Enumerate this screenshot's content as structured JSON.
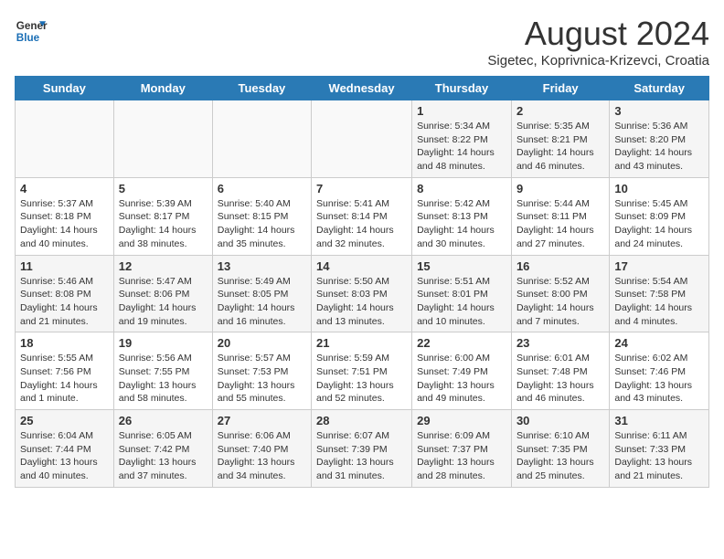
{
  "header": {
    "logo_line1": "General",
    "logo_line2": "Blue",
    "month": "August 2024",
    "location": "Sigetec, Koprivnica-Krizevci, Croatia"
  },
  "days_of_week": [
    "Sunday",
    "Monday",
    "Tuesday",
    "Wednesday",
    "Thursday",
    "Friday",
    "Saturday"
  ],
  "weeks": [
    [
      {
        "day": "",
        "info": ""
      },
      {
        "day": "",
        "info": ""
      },
      {
        "day": "",
        "info": ""
      },
      {
        "day": "",
        "info": ""
      },
      {
        "day": "1",
        "info": "Sunrise: 5:34 AM\nSunset: 8:22 PM\nDaylight: 14 hours\nand 48 minutes."
      },
      {
        "day": "2",
        "info": "Sunrise: 5:35 AM\nSunset: 8:21 PM\nDaylight: 14 hours\nand 46 minutes."
      },
      {
        "day": "3",
        "info": "Sunrise: 5:36 AM\nSunset: 8:20 PM\nDaylight: 14 hours\nand 43 minutes."
      }
    ],
    [
      {
        "day": "4",
        "info": "Sunrise: 5:37 AM\nSunset: 8:18 PM\nDaylight: 14 hours\nand 40 minutes."
      },
      {
        "day": "5",
        "info": "Sunrise: 5:39 AM\nSunset: 8:17 PM\nDaylight: 14 hours\nand 38 minutes."
      },
      {
        "day": "6",
        "info": "Sunrise: 5:40 AM\nSunset: 8:15 PM\nDaylight: 14 hours\nand 35 minutes."
      },
      {
        "day": "7",
        "info": "Sunrise: 5:41 AM\nSunset: 8:14 PM\nDaylight: 14 hours\nand 32 minutes."
      },
      {
        "day": "8",
        "info": "Sunrise: 5:42 AM\nSunset: 8:13 PM\nDaylight: 14 hours\nand 30 minutes."
      },
      {
        "day": "9",
        "info": "Sunrise: 5:44 AM\nSunset: 8:11 PM\nDaylight: 14 hours\nand 27 minutes."
      },
      {
        "day": "10",
        "info": "Sunrise: 5:45 AM\nSunset: 8:09 PM\nDaylight: 14 hours\nand 24 minutes."
      }
    ],
    [
      {
        "day": "11",
        "info": "Sunrise: 5:46 AM\nSunset: 8:08 PM\nDaylight: 14 hours\nand 21 minutes."
      },
      {
        "day": "12",
        "info": "Sunrise: 5:47 AM\nSunset: 8:06 PM\nDaylight: 14 hours\nand 19 minutes."
      },
      {
        "day": "13",
        "info": "Sunrise: 5:49 AM\nSunset: 8:05 PM\nDaylight: 14 hours\nand 16 minutes."
      },
      {
        "day": "14",
        "info": "Sunrise: 5:50 AM\nSunset: 8:03 PM\nDaylight: 14 hours\nand 13 minutes."
      },
      {
        "day": "15",
        "info": "Sunrise: 5:51 AM\nSunset: 8:01 PM\nDaylight: 14 hours\nand 10 minutes."
      },
      {
        "day": "16",
        "info": "Sunrise: 5:52 AM\nSunset: 8:00 PM\nDaylight: 14 hours\nand 7 minutes."
      },
      {
        "day": "17",
        "info": "Sunrise: 5:54 AM\nSunset: 7:58 PM\nDaylight: 14 hours\nand 4 minutes."
      }
    ],
    [
      {
        "day": "18",
        "info": "Sunrise: 5:55 AM\nSunset: 7:56 PM\nDaylight: 14 hours\nand 1 minute."
      },
      {
        "day": "19",
        "info": "Sunrise: 5:56 AM\nSunset: 7:55 PM\nDaylight: 13 hours\nand 58 minutes."
      },
      {
        "day": "20",
        "info": "Sunrise: 5:57 AM\nSunset: 7:53 PM\nDaylight: 13 hours\nand 55 minutes."
      },
      {
        "day": "21",
        "info": "Sunrise: 5:59 AM\nSunset: 7:51 PM\nDaylight: 13 hours\nand 52 minutes."
      },
      {
        "day": "22",
        "info": "Sunrise: 6:00 AM\nSunset: 7:49 PM\nDaylight: 13 hours\nand 49 minutes."
      },
      {
        "day": "23",
        "info": "Sunrise: 6:01 AM\nSunset: 7:48 PM\nDaylight: 13 hours\nand 46 minutes."
      },
      {
        "day": "24",
        "info": "Sunrise: 6:02 AM\nSunset: 7:46 PM\nDaylight: 13 hours\nand 43 minutes."
      }
    ],
    [
      {
        "day": "25",
        "info": "Sunrise: 6:04 AM\nSunset: 7:44 PM\nDaylight: 13 hours\nand 40 minutes."
      },
      {
        "day": "26",
        "info": "Sunrise: 6:05 AM\nSunset: 7:42 PM\nDaylight: 13 hours\nand 37 minutes."
      },
      {
        "day": "27",
        "info": "Sunrise: 6:06 AM\nSunset: 7:40 PM\nDaylight: 13 hours\nand 34 minutes."
      },
      {
        "day": "28",
        "info": "Sunrise: 6:07 AM\nSunset: 7:39 PM\nDaylight: 13 hours\nand 31 minutes."
      },
      {
        "day": "29",
        "info": "Sunrise: 6:09 AM\nSunset: 7:37 PM\nDaylight: 13 hours\nand 28 minutes."
      },
      {
        "day": "30",
        "info": "Sunrise: 6:10 AM\nSunset: 7:35 PM\nDaylight: 13 hours\nand 25 minutes."
      },
      {
        "day": "31",
        "info": "Sunrise: 6:11 AM\nSunset: 7:33 PM\nDaylight: 13 hours\nand 21 minutes."
      }
    ]
  ]
}
